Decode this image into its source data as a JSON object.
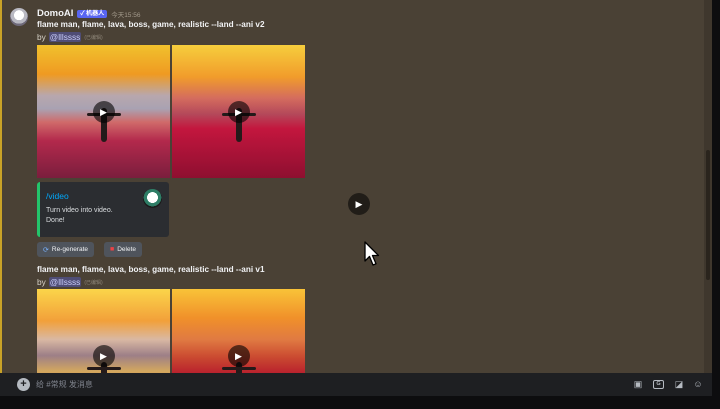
{
  "message": {
    "author": "DomoAI",
    "bot_badge": "✓ 机器人",
    "timestamp": "今天15:56"
  },
  "generations": [
    {
      "prompt": "flame man, flame, lava, boss, game, realistic --land --ani v2",
      "by_prefix": "by",
      "mention": "@lllssss",
      "tag": "(已编辑)"
    },
    {
      "prompt": "flame man, flame, lava, boss, game, realistic --land --ani v1",
      "by_prefix": "by",
      "mention": "@lllssss",
      "tag": "(已编辑)"
    }
  ],
  "embed": {
    "title": "/video",
    "line1": "Turn video into video.",
    "line2": "Done!"
  },
  "buttons": {
    "regenerate": "Re-generate",
    "delete": "Delete"
  },
  "composer": {
    "placeholder": "给 #常规 发消息"
  },
  "colors": {
    "chat_bg": "#4a4135",
    "embed_accent": "#23c46b",
    "link": "#00a8fc",
    "bot_badge": "#5865f2"
  },
  "icons": [
    "play-icon",
    "add-circle-icon",
    "gift-icon",
    "gif-icon",
    "sticker-icon",
    "emoji-icon",
    "refresh-icon",
    "delete-icon"
  ]
}
